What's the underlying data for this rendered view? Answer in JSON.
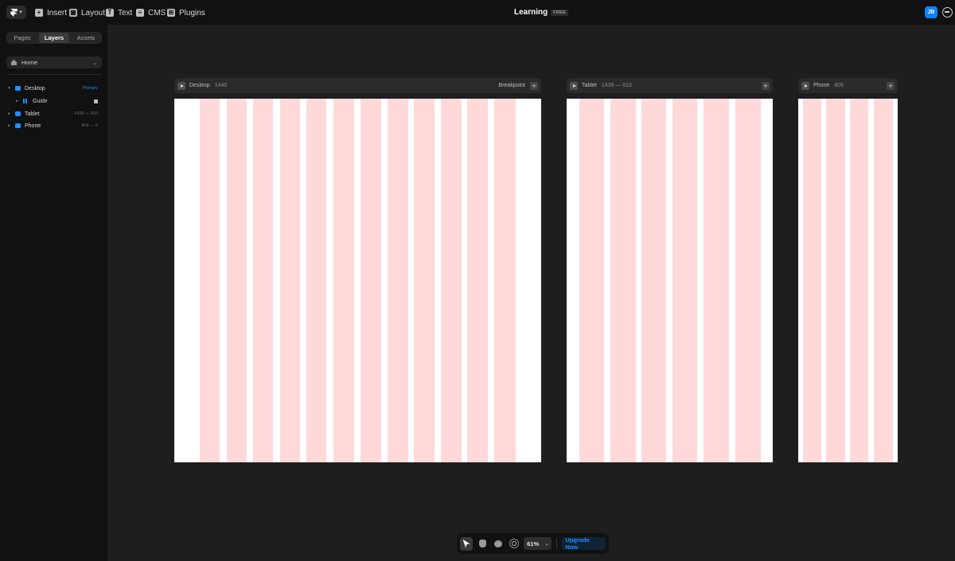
{
  "topbar": {
    "tools": [
      {
        "label": "Insert",
        "icon": "plus-square-icon"
      },
      {
        "label": "Layout",
        "icon": "layout-icon"
      },
      {
        "label": "Text",
        "icon": "text-icon"
      },
      {
        "label": "CMS",
        "icon": "database-icon"
      },
      {
        "label": "Plugins",
        "icon": "grid-icon"
      }
    ],
    "project_title": "Learning",
    "plan_badge": "FREE",
    "avatar_initials": "JB"
  },
  "sidebar": {
    "tabs": [
      {
        "label": "Pages",
        "active": false
      },
      {
        "label": "Layers",
        "active": true
      },
      {
        "label": "Assets",
        "active": false
      }
    ],
    "page_select": "Home",
    "layers": [
      {
        "label": "Desktop",
        "meta": "Primary",
        "level": 0
      },
      {
        "label": "Guide",
        "meta": "",
        "level": 1
      },
      {
        "label": "Tablet",
        "meta": "1439 — 810",
        "level": 0
      },
      {
        "label": "Phone",
        "meta": "809 — 0",
        "level": 0
      }
    ]
  },
  "breakpoints": [
    {
      "name": "Desktop",
      "size": "1440",
      "action_label": "Breakpoint"
    },
    {
      "name": "Tablet",
      "size": "1439 — 810",
      "action_label": ""
    },
    {
      "name": "Phone",
      "size": "809",
      "action_label": ""
    }
  ],
  "bottom_toolbar": {
    "zoom": "61%",
    "upgrade_label": "Upgrade Now"
  },
  "colors": {
    "accent": "#1f8fff",
    "guide_column": "#ffd9d9",
    "canvas": "#1e1e1e",
    "chrome": "#111111"
  }
}
